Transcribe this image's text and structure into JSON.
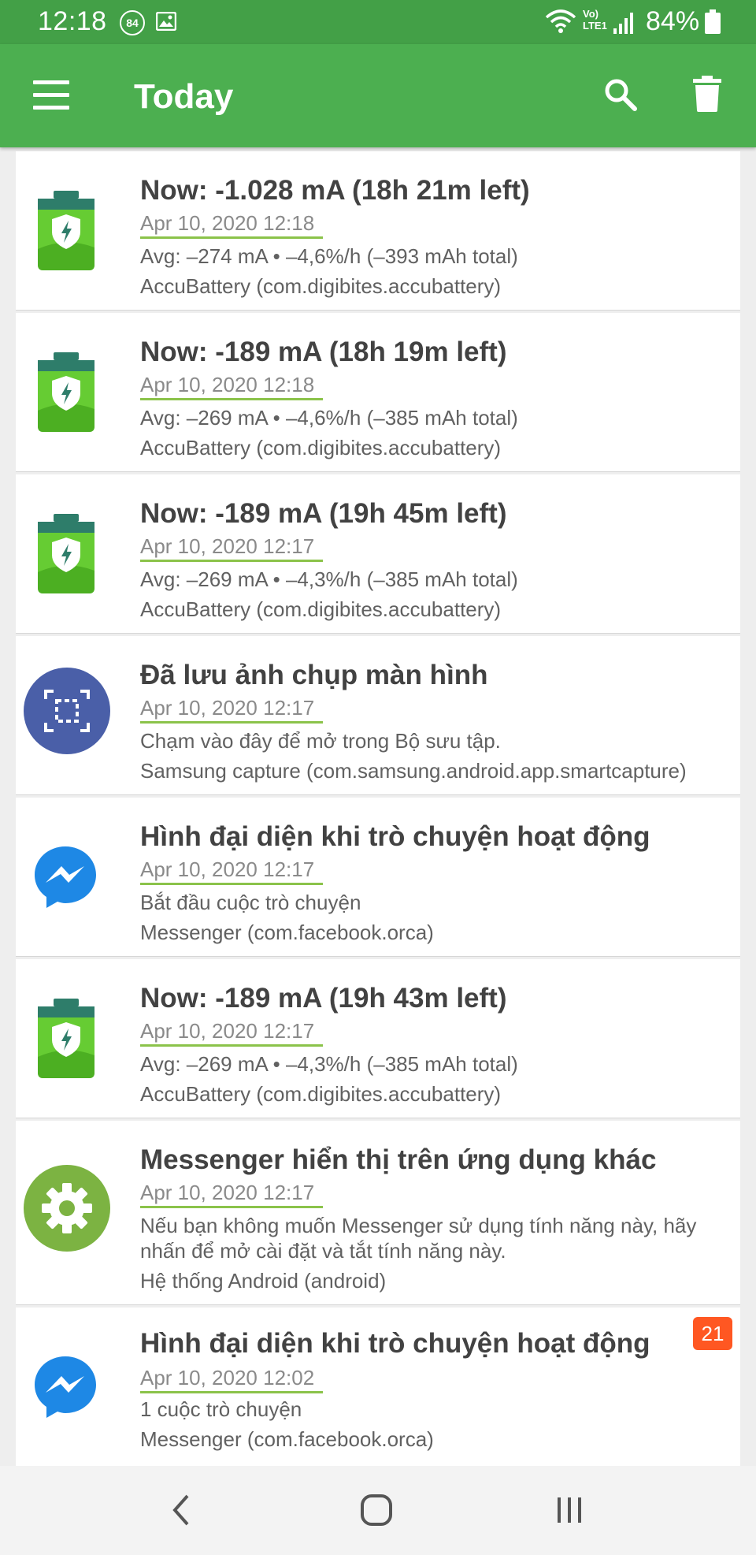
{
  "status_bar": {
    "time": "12:18",
    "notification_count": "84",
    "network": "Vo) LTE1",
    "battery_percent": "84%"
  },
  "app_bar": {
    "title": "Today",
    "icons": [
      "menu-icon",
      "search-icon",
      "delete-icon"
    ]
  },
  "colors": {
    "status_bar": "#43a047",
    "app_bar": "#4caf50",
    "accent_underline": "#8bc34a",
    "badge": "#ff5722"
  },
  "notifications": [
    {
      "icon": "battery-shield-icon",
      "title": "Now: -1.028 mA (18h 21m left)",
      "timestamp": "Apr 10, 2020   12:18",
      "lines": [
        "Avg: –274 mA • –4,6%/h (–393 mAh total)",
        "AccuBattery (com.digibites.accubattery)"
      ]
    },
    {
      "icon": "battery-shield-icon",
      "title": "Now: -189 mA (18h 19m left)",
      "timestamp": "Apr 10, 2020   12:18",
      "lines": [
        "Avg: –269 mA • –4,6%/h (–385 mAh total)",
        "AccuBattery (com.digibites.accubattery)"
      ]
    },
    {
      "icon": "battery-shield-icon",
      "title": "Now: -189 mA (19h 45m left)",
      "timestamp": "Apr 10, 2020   12:17",
      "lines": [
        "Avg: –269 mA • –4,3%/h (–385 mAh total)",
        "AccuBattery (com.digibites.accubattery)"
      ]
    },
    {
      "icon": "screenshot-capture-icon",
      "title": "Đã lưu ảnh chụp màn hình",
      "timestamp": "Apr 10, 2020   12:17",
      "lines": [
        "Chạm vào đây để mở trong Bộ sưu tập.",
        "Samsung capture (com.samsung.android.app.smartcapture)"
      ]
    },
    {
      "icon": "messenger-icon",
      "title": "Hình đại diện khi trò chuyện hoạt động",
      "timestamp": "Apr 10, 2020   12:17",
      "lines": [
        "Bắt đầu cuộc trò chuyện",
        "Messenger (com.facebook.orca)"
      ]
    },
    {
      "icon": "battery-shield-icon",
      "title": "Now: -189 mA (19h 43m left)",
      "timestamp": "Apr 10, 2020   12:17",
      "lines": [
        "Avg: –269 mA • –4,3%/h (–385 mAh total)",
        "AccuBattery (com.digibites.accubattery)"
      ]
    },
    {
      "icon": "android-settings-icon",
      "title": "Messenger hiển thị trên ứng dụng khác",
      "timestamp": "Apr 10, 2020   12:17",
      "lines": [
        "Nếu bạn không muốn Messenger sử dụng tính năng này, hãy",
        "nhấn để mở cài đặt và tắt tính năng này.",
        "Hệ thống Android (android)"
      ]
    },
    {
      "icon": "messenger-icon",
      "title": "Hình đại diện khi trò chuyện hoạt động",
      "timestamp": "Apr 10, 2020   12:02",
      "lines": [
        "1 cuộc trò chuyện",
        "Messenger (com.facebook.orca)"
      ],
      "badge": "21"
    }
  ],
  "nav_bar": {
    "icons": [
      "back-icon",
      "home-icon",
      "recent-apps-icon"
    ]
  }
}
